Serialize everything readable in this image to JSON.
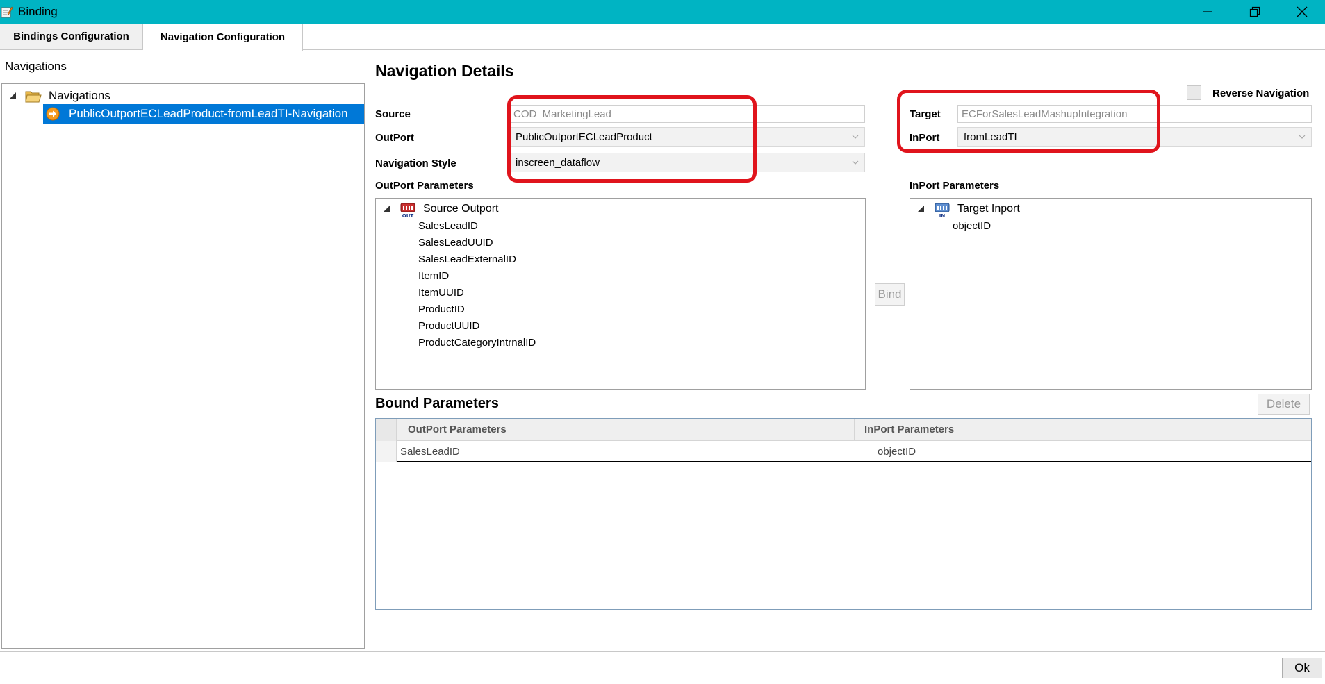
{
  "window": {
    "title": "Binding"
  },
  "tabs": [
    {
      "label": "Bindings Configuration",
      "active": false
    },
    {
      "label": "Navigation Configuration",
      "active": true
    }
  ],
  "left_panel": {
    "heading": "Navigations",
    "tree": {
      "root_label": "Navigations",
      "selected_item": "PublicOutportECLeadProduct-fromLeadTI-Navigation"
    }
  },
  "details": {
    "heading": "Navigation Details",
    "reverse_navigation_label": "Reverse Navigation",
    "reverse_navigation_checked": false,
    "source_label": "Source",
    "source_value": "COD_MarketingLead",
    "outport_label": "OutPort",
    "outport_value": "PublicOutportECLeadProduct",
    "nav_style_label": "Navigation Style",
    "nav_style_value": "inscreen_dataflow",
    "target_label": "Target",
    "target_value": "ECForSalesLeadMashupIntegration",
    "inport_label": "InPort",
    "inport_value": "fromLeadTI"
  },
  "outport_params": {
    "heading": "OutPort Parameters",
    "root_label": "Source Outport",
    "items": [
      "SalesLeadID",
      "SalesLeadUUID",
      "SalesLeadExternalID",
      "ItemID",
      "ItemUUID",
      "ProductID",
      "ProductUUID",
      "ProductCategoryIntrnalID"
    ]
  },
  "inport_params": {
    "heading": "InPort Parameters",
    "root_label": "Target Inport",
    "items": [
      "objectID"
    ]
  },
  "bind_button": "Bind",
  "bound": {
    "heading": "Bound Parameters",
    "delete_button": "Delete",
    "columns": [
      "OutPort Parameters",
      "InPort Parameters"
    ],
    "rows": [
      {
        "outport": "SalesLeadID",
        "inport": "objectID"
      }
    ]
  },
  "ok_button": "Ok",
  "colors": {
    "titlebar": "#00b4c3",
    "selection": "#0078d7",
    "highlight": "#e0141c"
  }
}
